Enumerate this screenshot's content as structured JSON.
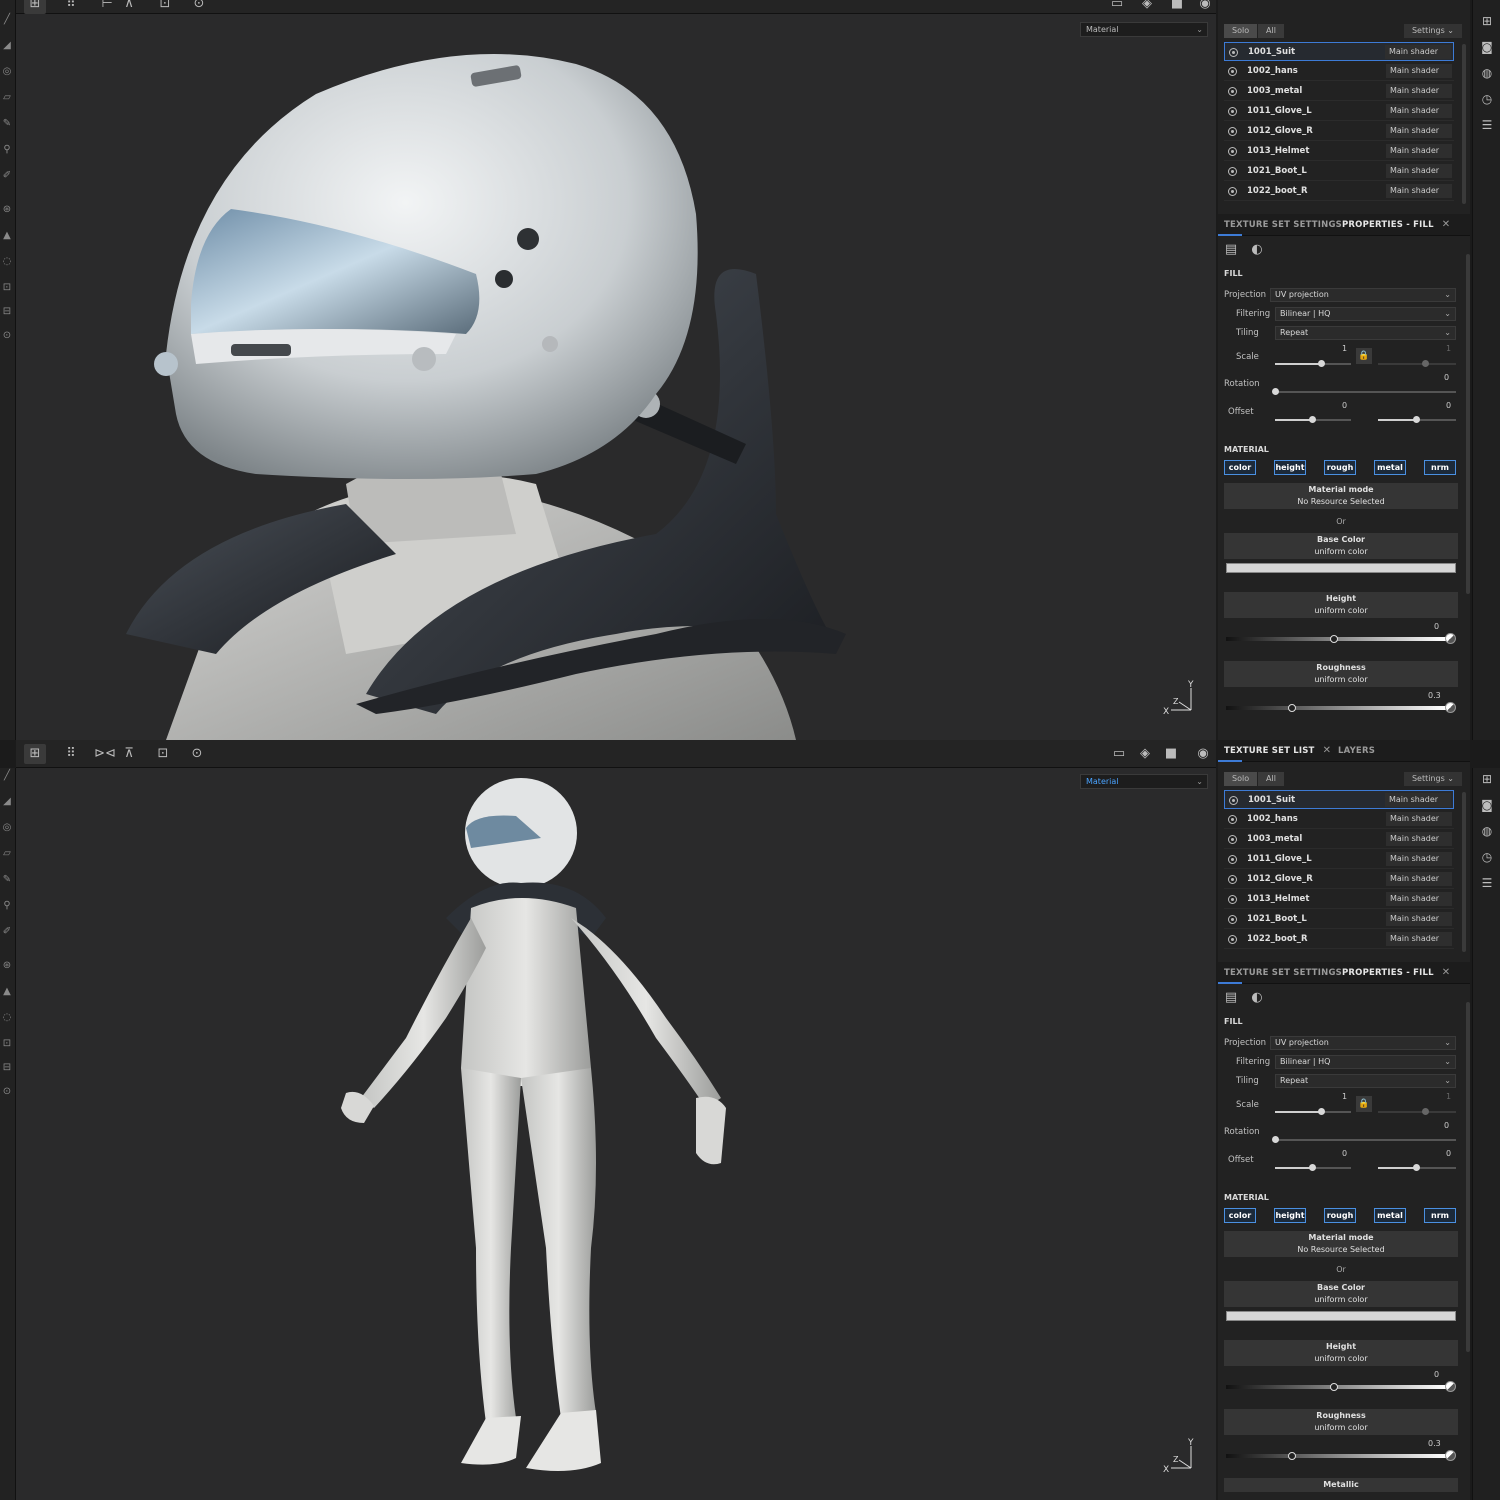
{
  "viewport": {
    "top_mode": "Material",
    "bottom_mode": "Material"
  },
  "texture_set_list": {
    "tab_label": "TEXTURE SET LIST",
    "layers_label": "LAYERS",
    "solo_label": "Solo",
    "all_label": "All",
    "settings_label": "Settings",
    "items": [
      {
        "name": "1001_Suit",
        "shader": "Main shader"
      },
      {
        "name": "1002_hans",
        "shader": "Main shader"
      },
      {
        "name": "1003_metal",
        "shader": "Main shader"
      },
      {
        "name": "1011_Glove_L",
        "shader": "Main shader"
      },
      {
        "name": "1012_Glove_R",
        "shader": "Main shader"
      },
      {
        "name": "1013_Helmet",
        "shader": "Main shader"
      },
      {
        "name": "1021_Boot_L",
        "shader": "Main shader"
      },
      {
        "name": "1022_boot_R",
        "shader": "Main shader"
      }
    ]
  },
  "properties": {
    "tab_texture_set_settings": "TEXTURE SET SETTINGS",
    "tab_properties_fill": "PROPERTIES - FILL",
    "fill_title": "FILL",
    "projection_label": "Projection",
    "projection_value": "UV projection",
    "filtering_label": "Filtering",
    "filtering_value": "Bilinear | HQ",
    "tiling_label": "Tiling",
    "tiling_value": "Repeat",
    "scale_label": "Scale",
    "scale_value": "1",
    "scale_value_locked": "1",
    "rotation_label": "Rotation",
    "rotation_value": "0",
    "offset_label": "Offset",
    "offset_u": "0",
    "offset_v": "0",
    "material_title": "MATERIAL",
    "channels": [
      "color",
      "height",
      "rough",
      "metal",
      "nrm"
    ],
    "material_mode_title": "Material mode",
    "material_mode_sub": "No Resource Selected",
    "or_label": "Or",
    "base_color_title": "Base Color",
    "base_color_sub": "uniform color",
    "height_title": "Height",
    "height_sub": "uniform color",
    "height_value": "0",
    "roughness_title": "Roughness",
    "roughness_sub": "uniform color",
    "roughness_value": "0.3",
    "metallic_title": "Metallic"
  },
  "colors": {
    "accent": "#3d7bd6",
    "viewport_bg": "#2a2a2b",
    "panel_bg": "#222222"
  }
}
